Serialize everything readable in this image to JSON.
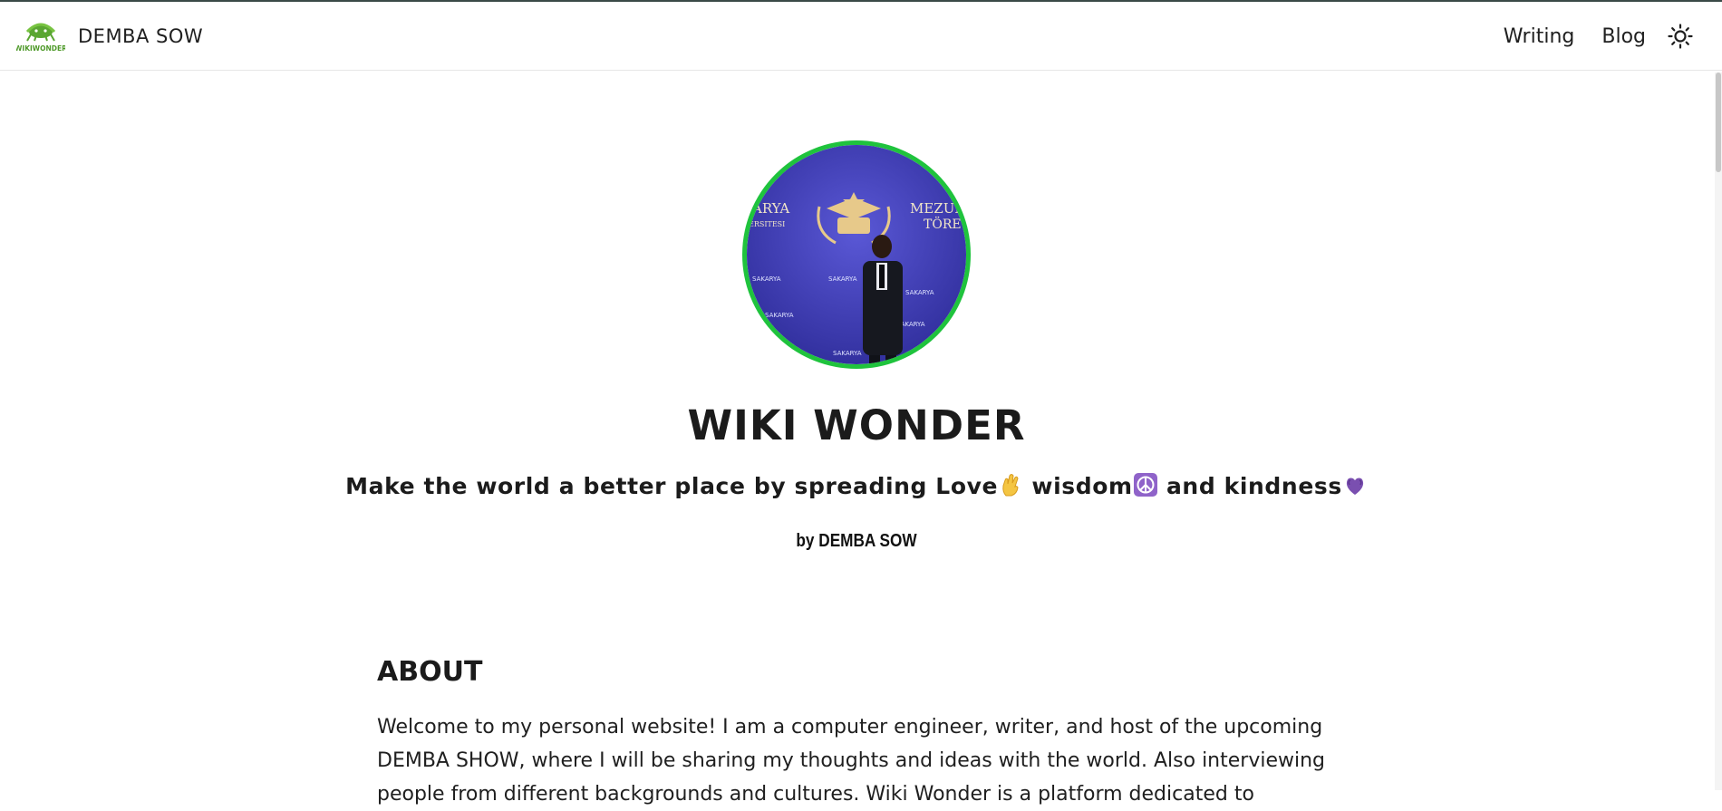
{
  "nav": {
    "brand_name": "DEMBA SOW",
    "logo_text": "WIKIWONDER",
    "links": [
      "Writing",
      "Blog"
    ],
    "theme_icon": "sun-icon"
  },
  "hero": {
    "avatar_backdrop_text_left": "ARYA",
    "avatar_backdrop_text_left_sub": "ERSITESI",
    "avatar_backdrop_text_right": "MEZUN",
    "avatar_backdrop_text_right_sub": "TÖRE",
    "avatar_backdrop_logo_text": "SAKARYA",
    "title": "WIKI WONDER",
    "tagline": {
      "part1": "Make the world a better place by spreading Love",
      "part2": " wisdom",
      "part3": " and kindness"
    },
    "byline": "by DEMBA SOW"
  },
  "about": {
    "heading": "ABOUT",
    "text": "Welcome to my personal website! I am a computer engineer, writer, and host of the upcoming DEMBA SHOW, where I will be sharing my thoughts and ideas with the world. Also interviewing people from different backgrounds and cultures. Wiki Wonder is a platform dedicated to"
  },
  "colors": {
    "avatar_ring": "#1fc33d",
    "logo_green": "#6dbf3a",
    "backdrop": "#3d3bb0"
  }
}
